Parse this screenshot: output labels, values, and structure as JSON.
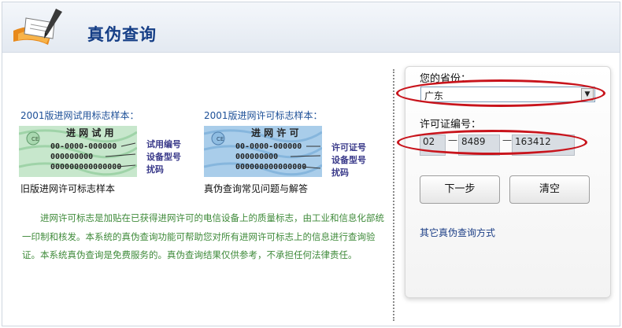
{
  "header": {
    "title": "真伪查询"
  },
  "samples": {
    "trial": {
      "label": "2001版进网试用标志样本：",
      "stamp_title": "进 网 试 用",
      "number": "00-0000-000000",
      "line2": "000000000",
      "line3": "000000000000000",
      "callouts": [
        "试用编号",
        "设备型号",
        "扰码"
      ],
      "link": "旧版进网许可标志样本"
    },
    "license": {
      "label": "2001版进网许可标志样本：",
      "stamp_title": "进 网 许 可",
      "number": "00-0000-000000",
      "line2": "000000000",
      "line3": "000000000000000",
      "callouts": [
        "许可证号",
        "设备型号",
        "扰码"
      ],
      "link": "真伪查询常见问题与解答"
    }
  },
  "description": "进网许可标志是加贴在已获得进网许可的电信设备上的质量标志，由工业和信息化部统一印制和核发。本系统的真伪查询功能可帮助您对所有进网许可标志上的信息进行查询验证。本系统真伪查询是免费服务的。真伪查询结果仅供参考，不承担任何法律责任。",
  "form": {
    "province_label": "您的省份：",
    "province_value": "广东",
    "license_label": "许可证编号：",
    "license_part1": "02",
    "license_part2": "8489",
    "license_part3": "163412",
    "separator": "—",
    "next_button": "下一步",
    "clear_button": "清空",
    "other_link": "其它真伪查询方式"
  },
  "colors": {
    "title": "#153e86",
    "description": "#3f8a3a",
    "highlight": "#c8141c"
  }
}
